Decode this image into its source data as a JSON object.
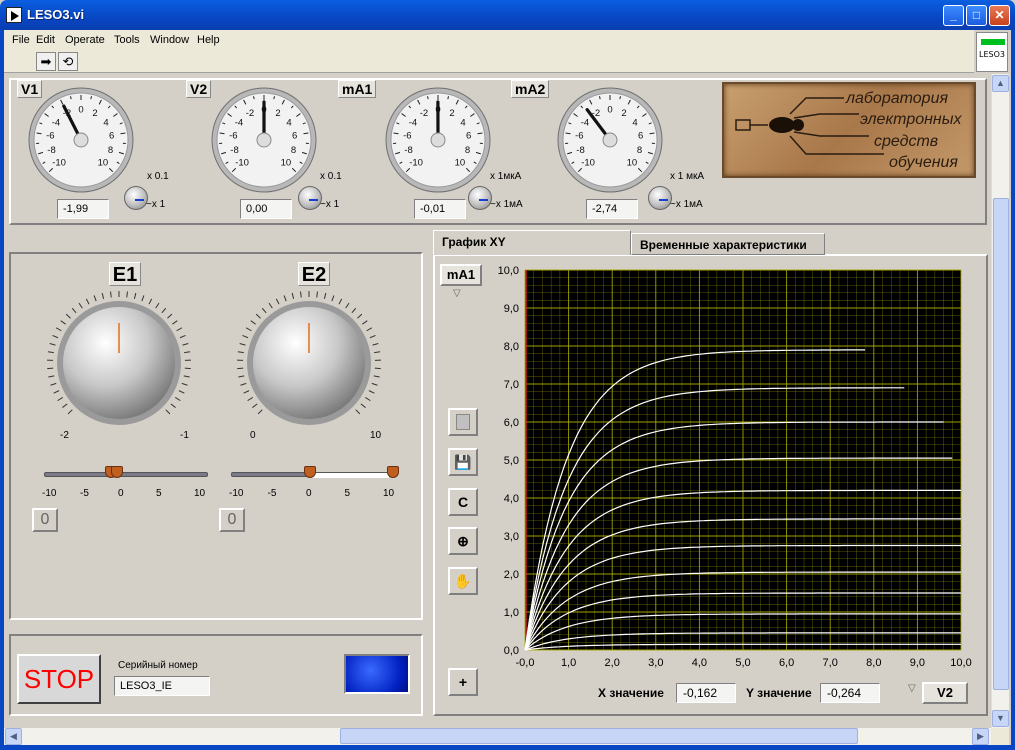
{
  "window": {
    "title": "LESO3.vi",
    "minimize": "_",
    "maximize": "□",
    "close": "✕"
  },
  "menu": {
    "file": "File",
    "edit": "Edit",
    "operate": "Operate",
    "tools": "Tools",
    "window": "Window",
    "help": "Help"
  },
  "toolbar": {
    "run_icon": "run-arrow-icon",
    "run_continuous_icon": "run-continuously-icon",
    "badge": "LESO3"
  },
  "meters": [
    {
      "label": "V1",
      "ticks": [
        "-10",
        "-8",
        "-6",
        "-4",
        "-2",
        "0",
        "2",
        "4",
        "6",
        "8",
        "10"
      ],
      "value": -1.99,
      "readout": "-1,99",
      "range_top": "x 0.1",
      "range_bottom": "~x 1"
    },
    {
      "label": "V2",
      "ticks": [
        "-10",
        "-8",
        "-6",
        "-4",
        "-2",
        "0",
        "2",
        "4",
        "6",
        "8",
        "10"
      ],
      "value": 0.0,
      "readout": "0,00",
      "range_top": "x 0.1",
      "range_bottom": "~x 1"
    },
    {
      "label": "mA1",
      "ticks": [
        "-10",
        "-8",
        "-6",
        "-4",
        "-2",
        "0",
        "2",
        "4",
        "6",
        "8",
        "10"
      ],
      "value": -0.01,
      "readout": "-0,01",
      "range_top": "x 1мкА",
      "range_bottom": "~x 1мА"
    },
    {
      "label": "mA2",
      "ticks": [
        "-10",
        "-8",
        "-6",
        "-4",
        "-2",
        "0",
        "2",
        "4",
        "6",
        "8",
        "10"
      ],
      "value": -2.74,
      "readout": "-2,74",
      "range_top": "x 1 мкА",
      "range_bottom": "~x 1мА"
    }
  ],
  "logo": {
    "line1": "лаборатория",
    "line2": "электронных",
    "line3": "средств",
    "line4": "обучения"
  },
  "sources": [
    {
      "label": "E1",
      "knob_min": "-2",
      "knob_max": "-1",
      "knob_value": -1.5,
      "slider_ticks": [
        "-10",
        "-5",
        "0",
        "5",
        "10"
      ],
      "slider_value": -1.5,
      "indicator": "0"
    },
    {
      "label": "E2",
      "knob_min": "0",
      "knob_max": "10",
      "knob_value": 5,
      "slider_ticks": [
        "-10",
        "-5",
        "0",
        "5",
        "10"
      ],
      "slider_value": 0,
      "indicator": "0"
    }
  ],
  "stop": {
    "label": "STOP"
  },
  "serial": {
    "label": "Серийный номер",
    "value": "LESO3_IE"
  },
  "tabs": [
    {
      "label": "График XY",
      "active": true
    },
    {
      "label": "Временные характеристики",
      "active": false
    }
  ],
  "graph": {
    "y_channel": "mA1",
    "x_channel": "V2",
    "clear_label": "C",
    "x_label": "X значение",
    "x_value": "-0,162",
    "y_label": "Y значение",
    "y_value": "-0,264",
    "x_ticks": [
      "-0,0",
      "1,0",
      "2,0",
      "3,0",
      "4,0",
      "5,0",
      "6,0",
      "7,0",
      "8,0",
      "9,0",
      "10,0"
    ],
    "y_ticks": [
      "0,0",
      "1,0",
      "2,0",
      "3,0",
      "4,0",
      "5,0",
      "6,0",
      "7,0",
      "8,0",
      "9,0",
      "10,0"
    ]
  },
  "chart_data": {
    "type": "line",
    "xlim": [
      0,
      10
    ],
    "ylim": [
      0,
      10
    ],
    "grid": true,
    "series": [
      {
        "plateau": 7.9,
        "x_end": 7.8
      },
      {
        "plateau": 6.9,
        "x_end": 8.7
      },
      {
        "plateau": 6.0,
        "x_end": 9.6
      },
      {
        "plateau": 5.05,
        "x_end": 9.8
      },
      {
        "plateau": 4.2,
        "x_end": 10
      },
      {
        "plateau": 3.45,
        "x_end": 10
      },
      {
        "plateau": 2.75,
        "x_end": 10
      },
      {
        "plateau": 2.05,
        "x_end": 10
      },
      {
        "plateau": 1.5,
        "x_end": 10
      },
      {
        "plateau": 0.95,
        "x_end": 10
      },
      {
        "plateau": 0.45,
        "x_end": 10
      },
      {
        "plateau": 0.15,
        "x_end": 10
      }
    ]
  },
  "colors": {
    "plot_bg": "#000000",
    "grid": "#a8a800",
    "trace": "#ffffff",
    "stop_text": "#ff0000",
    "led_on": "#1a40ff",
    "knob_pointer": "#e07020"
  }
}
